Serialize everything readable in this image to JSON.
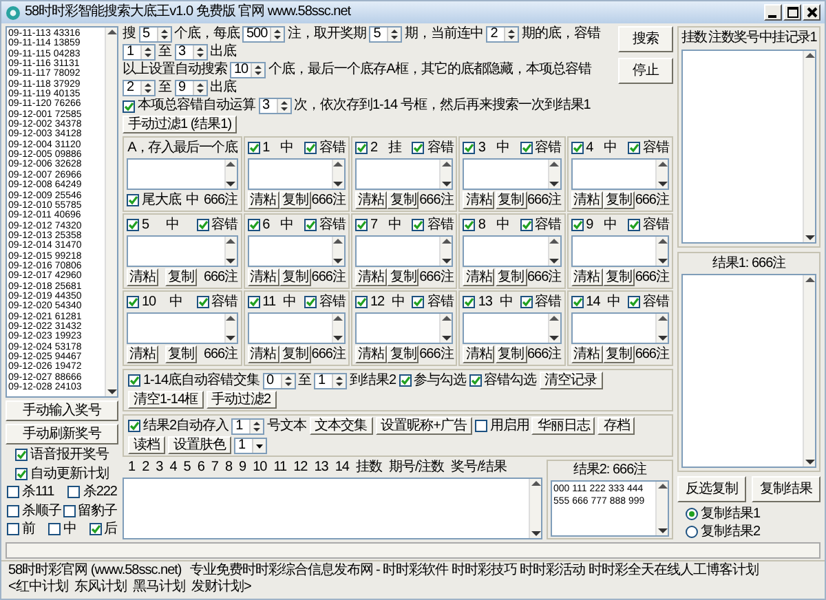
{
  "window": {
    "title": "58时时彩智能搜索大底王v1.0 免费版 官网 www.58ssc.net"
  },
  "history": [
    "09-11-113 43316",
    "09-11-114 13859",
    "09-11-115 04283",
    "09-11-116 31131",
    "09-11-117 78092",
    "09-11-118 37929",
    "09-11-119 40135",
    "09-11-120 76266",
    "09-12-001 72585",
    "09-12-002 34378",
    "09-12-003 34128",
    "09-12-004 31120",
    "09-12-005 09886",
    "09-12-006 32628",
    "09-12-007 26966",
    "09-12-008 64249",
    "09-12-009 25546",
    "09-12-010 55785",
    "09-12-011 40696",
    "09-12-012 74320",
    "09-12-013 25358",
    "09-12-014 31470",
    "09-12-015 99218",
    "09-12-016 70806",
    "09-12-017 42960",
    "09-12-018 25681",
    "09-12-019 44350",
    "09-12-020 54340",
    "09-12-021 61281",
    "09-12-022 31432",
    "09-12-023 19923",
    "09-12-024 53178",
    "09-12-025 94467",
    "09-12-026 19472",
    "09-12-027 88666",
    "09-12-028 24103"
  ],
  "left_buttons": [
    "手动输入奖号",
    "手动刷新奖号"
  ],
  "left_options": [
    [
      {
        "label": "语音报开奖号",
        "checked": true
      }
    ],
    [
      {
        "label": "自动更新计划",
        "checked": true
      }
    ],
    [
      {
        "label": "杀111",
        "checked": false
      },
      {
        "label": "杀222",
        "checked": false
      }
    ],
    [
      {
        "label": "杀顺子",
        "checked": false
      },
      {
        "label": "留豹子",
        "checked": false
      }
    ],
    [
      {
        "label": "前",
        "checked": false
      },
      {
        "label": "中",
        "checked": false
      },
      {
        "label": "后",
        "checked": true
      }
    ]
  ],
  "settings": [
    [
      {
        "kind": "text",
        "text": "搜"
      },
      {
        "kind": "spin",
        "value": "5"
      },
      {
        "kind": "text",
        "text": "个底，每底"
      },
      {
        "kind": "spin",
        "value": "500"
      },
      {
        "kind": "text",
        "text": "注，取开奖期"
      },
      {
        "kind": "spin",
        "value": "5"
      },
      {
        "kind": "text",
        "text": "期，当前连中"
      },
      {
        "kind": "spin",
        "value": "2"
      },
      {
        "kind": "text",
        "text": "期的底，容错"
      },
      {
        "kind": "spin",
        "value": "1"
      },
      {
        "kind": "text",
        "text": "至"
      },
      {
        "kind": "spin",
        "value": "3"
      },
      {
        "kind": "text",
        "text": "出底"
      }
    ],
    [
      {
        "kind": "text",
        "text": "以上设置自动搜索"
      },
      {
        "kind": "spin",
        "value": "10"
      },
      {
        "kind": "text",
        "text": "个底，最后一个底存A框，其它的底都隐藏，本项总容错"
      },
      {
        "kind": "spin",
        "value": "2"
      },
      {
        "kind": "text",
        "text": "至"
      },
      {
        "kind": "spin",
        "value": "9"
      },
      {
        "kind": "text",
        "text": "出底"
      }
    ],
    [
      {
        "kind": "check",
        "label": "本项总容错自动运算",
        "checked": true
      },
      {
        "kind": "spin",
        "value": "3"
      },
      {
        "kind": "text",
        "text": "次，依次存到1-14 号框，然后再来搜索一次到结果1"
      },
      {
        "kind": "button",
        "label": "手动过滤1 (结果1)"
      }
    ]
  ],
  "side_buttons": [
    "搜索",
    "停止"
  ],
  "box_a": {
    "title": "A，存入最后一个底",
    "option": {
      "label": "尾大底",
      "checked": true
    },
    "status": "中",
    "count": "666注"
  },
  "boxes": [
    {
      "number": "1",
      "checked": true,
      "status": "中",
      "tolerance": {
        "label": "容错",
        "checked": true
      },
      "buttons": [
        "清粘",
        "复制"
      ],
      "count": "666注"
    },
    {
      "number": "2",
      "checked": true,
      "status": "挂",
      "tolerance": {
        "label": "容错",
        "checked": true
      },
      "buttons": [
        "清粘",
        "复制"
      ],
      "count": "666注"
    },
    {
      "number": "3",
      "checked": true,
      "status": "中",
      "tolerance": {
        "label": "容错",
        "checked": true
      },
      "buttons": [
        "清粘",
        "复制"
      ],
      "count": "666注"
    },
    {
      "number": "4",
      "checked": true,
      "status": "中",
      "tolerance": {
        "label": "容错",
        "checked": true
      },
      "buttons": [
        "清粘",
        "复制"
      ],
      "count": "666注"
    },
    {
      "number": "5",
      "checked": true,
      "status": "中",
      "tolerance": {
        "label": "容错",
        "checked": true
      },
      "buttons": [
        "清粘",
        "复制"
      ],
      "count": "666注"
    },
    {
      "number": "6",
      "checked": true,
      "status": "中",
      "tolerance": {
        "label": "容错",
        "checked": true
      },
      "buttons": [
        "清粘",
        "复制"
      ],
      "count": "666注"
    },
    {
      "number": "7",
      "checked": true,
      "status": "中",
      "tolerance": {
        "label": "容错",
        "checked": true
      },
      "buttons": [
        "清粘",
        "复制"
      ],
      "count": "666注"
    },
    {
      "number": "8",
      "checked": true,
      "status": "中",
      "tolerance": {
        "label": "容错",
        "checked": true
      },
      "buttons": [
        "清粘",
        "复制"
      ],
      "count": "666注"
    },
    {
      "number": "9",
      "checked": true,
      "status": "中",
      "tolerance": {
        "label": "容错",
        "checked": true
      },
      "buttons": [
        "清粘",
        "复制"
      ],
      "count": "666注"
    },
    {
      "number": "10",
      "checked": true,
      "status": "中",
      "tolerance": {
        "label": "容错",
        "checked": true
      },
      "buttons": [
        "清粘",
        "复制"
      ],
      "count": "666注"
    },
    {
      "number": "11",
      "checked": true,
      "status": "中",
      "tolerance": {
        "label": "容错",
        "checked": true
      },
      "buttons": [
        "清粘",
        "复制"
      ],
      "count": "666注"
    },
    {
      "number": "12",
      "checked": true,
      "status": "中",
      "tolerance": {
        "label": "容错",
        "checked": true
      },
      "buttons": [
        "清粘",
        "复制"
      ],
      "count": "666注"
    },
    {
      "number": "13",
      "checked": true,
      "status": "中",
      "tolerance": {
        "label": "容错",
        "checked": true
      },
      "buttons": [
        "清粘",
        "复制"
      ],
      "count": "666注"
    },
    {
      "number": "14",
      "checked": true,
      "status": "中",
      "tolerance": {
        "label": "容错",
        "checked": true
      },
      "buttons": [
        "清粘",
        "复制"
      ],
      "count": "666注"
    }
  ],
  "controls": [
    [
      {
        "kind": "check",
        "label": "1-14底自动容错交集",
        "checked": true
      },
      {
        "kind": "spin",
        "value": "0"
      },
      {
        "kind": "text",
        "text": "至"
      },
      {
        "kind": "spin",
        "value": "1"
      },
      {
        "kind": "text",
        "text": "到结果2"
      },
      {
        "kind": "check",
        "label": "参与勾选",
        "checked": true
      },
      {
        "kind": "check",
        "label": "容错勾选",
        "checked": true
      },
      {
        "kind": "button",
        "label": "清空记录"
      },
      {
        "kind": "button",
        "label": "清空1-14框"
      },
      {
        "kind": "button",
        "label": "手动过滤2"
      }
    ],
    [
      {
        "kind": "check",
        "label": "结果2自动存入",
        "checked": true
      },
      {
        "kind": "spin",
        "value": "1"
      },
      {
        "kind": "text",
        "text": "号文本"
      },
      {
        "kind": "button",
        "label": "文本交集"
      },
      {
        "kind": "button",
        "label": "设置昵称+广告"
      },
      {
        "kind": "check",
        "label": "用启用",
        "checked": false
      },
      {
        "kind": "button",
        "label": "华丽日志"
      },
      {
        "kind": "button",
        "label": "存档"
      },
      {
        "kind": "button",
        "label": "读档"
      },
      {
        "kind": "button",
        "label": "设置肤色"
      },
      {
        "kind": "select",
        "value": "1"
      }
    ]
  ],
  "record_table": {
    "columns": [
      "1",
      "2",
      "3",
      "4",
      "5",
      "6",
      "7",
      "8",
      "9",
      "10",
      "11",
      "12",
      "13",
      "14",
      "挂数",
      "期号/注数",
      "奖号/结果"
    ]
  },
  "result2": {
    "title": "结果2: 666注",
    "lines": [
      "000 111 222 333 444",
      "555 666 777 888 999"
    ]
  },
  "record_panel": {
    "columns": [
      "挂数",
      "注数奖号中挂记录1"
    ]
  },
  "result1": {
    "title": "结果1: 666注",
    "buttons": [
      "反选复制",
      "复制结果"
    ],
    "options": [
      {
        "label": "复制结果1",
        "selected": true
      },
      {
        "label": "复制结果2",
        "selected": false
      }
    ]
  },
  "status_bar": [
    "58时时彩官网 (www.58ssc.net)",
    "专业免费时时彩综合信息发布网 - 时时彩软件 时时彩技巧 时时彩活动 时时彩全天在线人工博客计划",
    "<红中计划  东风计划  黑马计划  发财计划>"
  ]
}
